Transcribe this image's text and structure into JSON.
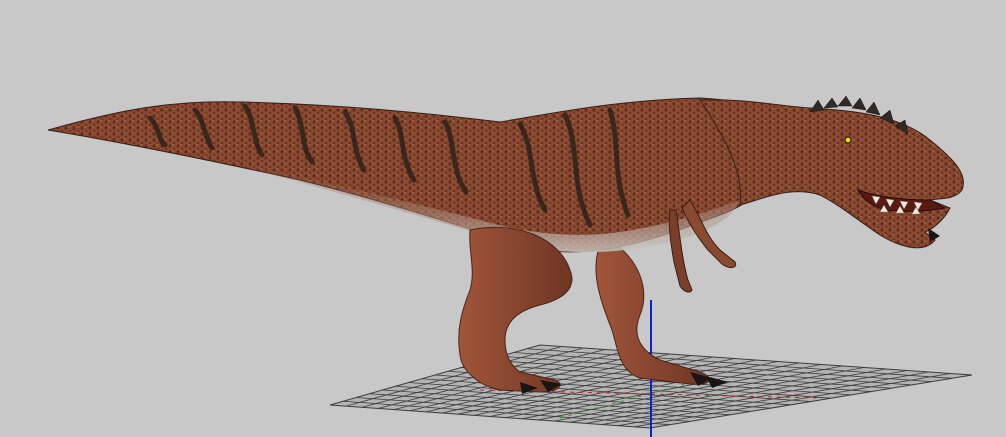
{
  "viewport": {
    "background_color": "#c8c8c8"
  },
  "model": {
    "subject": "theropod-dinosaur",
    "skin_color": "#8a4a32",
    "stripe_color": "#2a1f18",
    "belly_color": "#c9c3bd",
    "claw_color": "#1a1412",
    "eye_color": "#e8d800"
  },
  "ground_grid": {
    "line_color": "#3c3c3c",
    "plane_color": "#b4b4b4"
  },
  "axes": {
    "vertical_axis_color": "#1020d0",
    "x_axis_color": "#c02020",
    "z_axis_color": "#20a020"
  }
}
